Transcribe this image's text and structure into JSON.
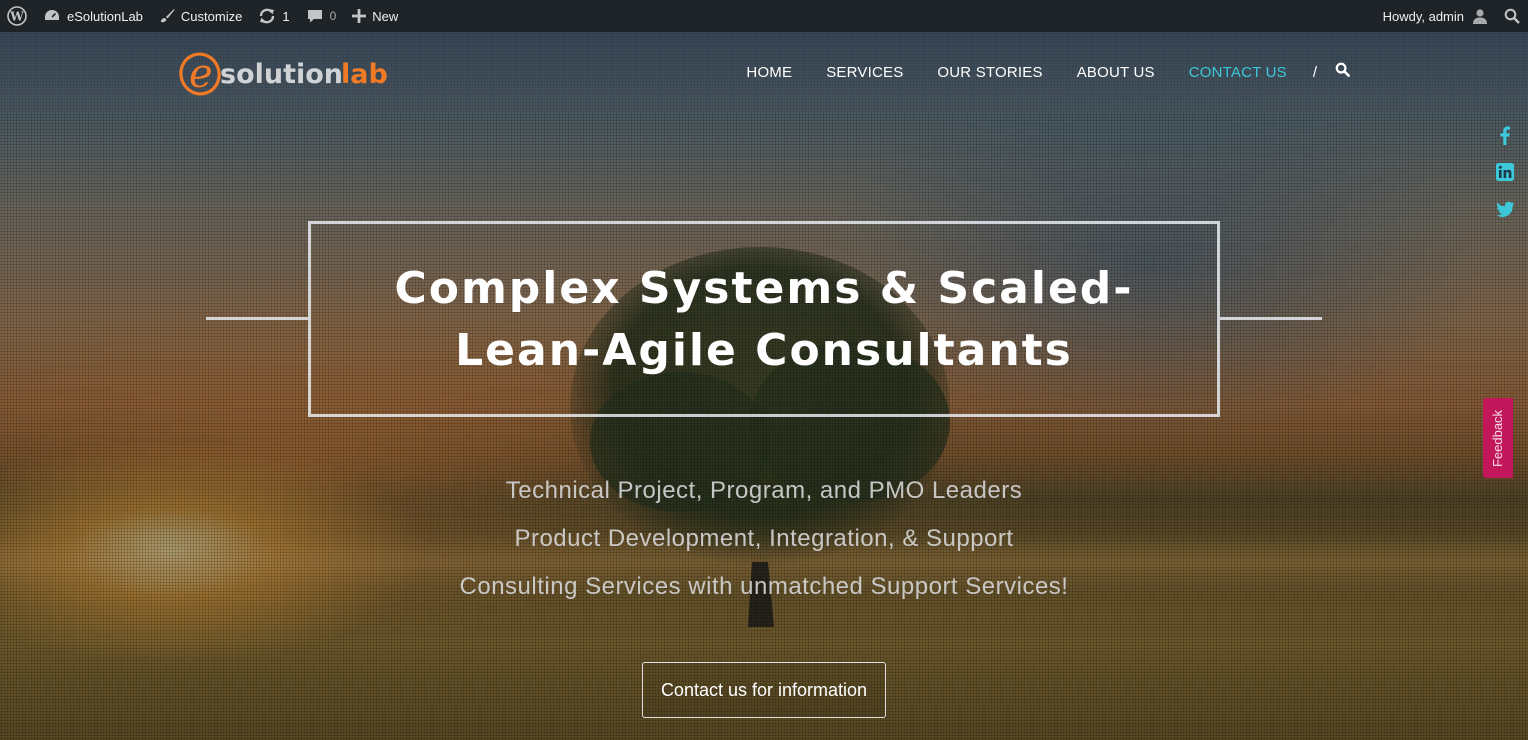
{
  "admin_bar": {
    "site_name": "eSolutionLab",
    "customize": "Customize",
    "updates_count": "1",
    "comments_count": "0",
    "new_label": "New",
    "greeting": "Howdy, admin"
  },
  "header": {
    "logo_text_e": "e",
    "logo_text_solution": "solution",
    "logo_text_lab": "lab",
    "nav": [
      {
        "label": "HOME"
      },
      {
        "label": "SERVICES"
      },
      {
        "label": "OUR STORIES"
      },
      {
        "label": "ABOUT US"
      },
      {
        "label": "CONTACT US",
        "active": true
      }
    ],
    "separator": "/"
  },
  "hero": {
    "title_line1": "Complex Systems & Scaled-",
    "title_line2": "Lean-Agile Consultants",
    "subtitles": [
      "Technical Project, Program, and PMO Leaders",
      "Product Development, Integration, & Support",
      "Consulting Services with unmatched Support Services!"
    ],
    "cta_label": "Contact us for information"
  },
  "feedback_label": "Feedback",
  "social_icons": [
    "facebook-icon",
    "linkedin-icon",
    "twitter-icon"
  ],
  "colors": {
    "accent": "#3cc8d8",
    "logo_orange": "#f07a26",
    "feedback": "#c2185b",
    "admin_bar": "#1d2327"
  }
}
